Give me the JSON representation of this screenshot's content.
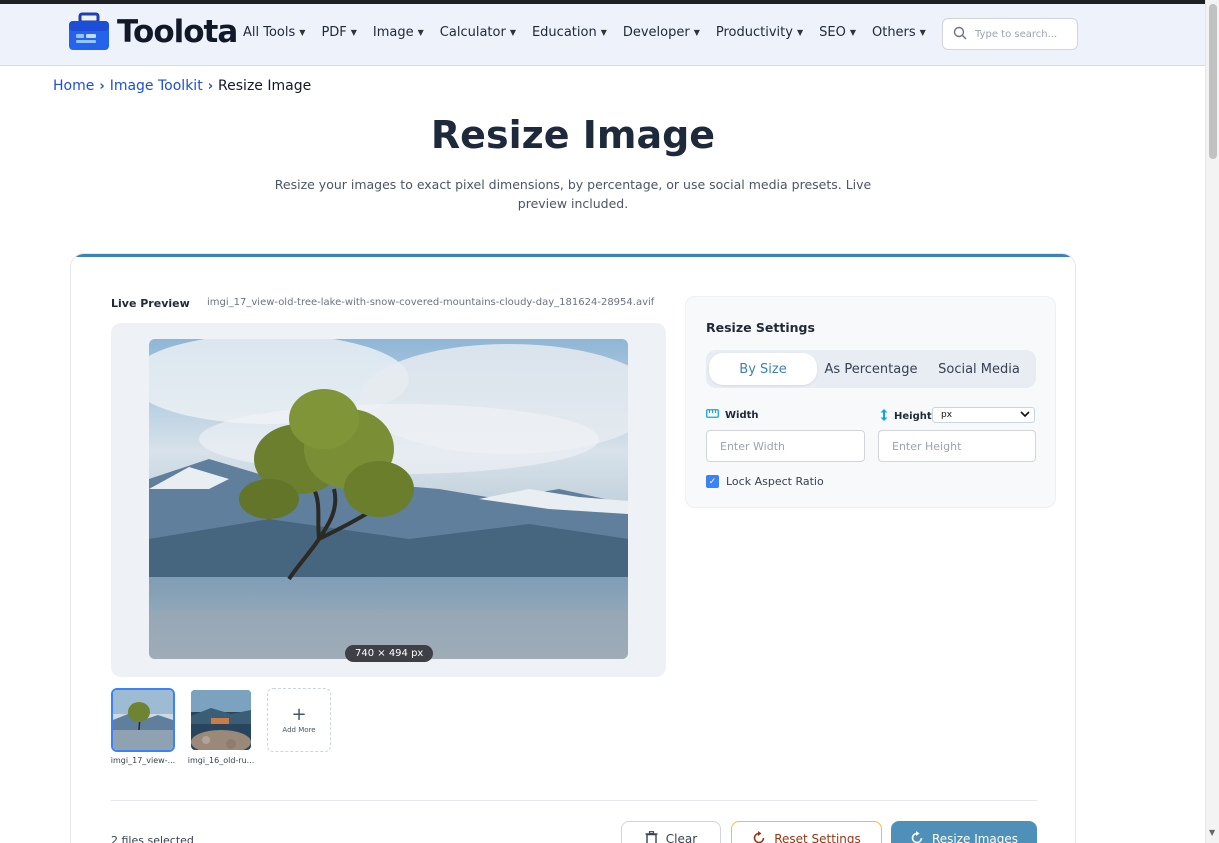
{
  "brand": {
    "name": "Toolota"
  },
  "nav": {
    "items": [
      {
        "label": "All Tools"
      },
      {
        "label": "PDF"
      },
      {
        "label": "Image"
      },
      {
        "label": "Calculator"
      },
      {
        "label": "Education"
      },
      {
        "label": "Developer"
      },
      {
        "label": "Productivity"
      },
      {
        "label": "SEO"
      },
      {
        "label": "Others"
      }
    ],
    "search_placeholder": "Type to search..."
  },
  "breadcrumb": {
    "home": "Home",
    "section": "Image Toolkit",
    "current": "Resize Image"
  },
  "page": {
    "title": "Resize Image",
    "subtitle": "Resize your images to exact pixel dimensions, by percentage, or use social media presets. Live preview included."
  },
  "preview": {
    "label": "Live Preview",
    "file_name": "imgi_17_view-old-tree-lake-with-snow-covered-mountains-cloudy-day_181624-28954.avif",
    "dimensions": "740 × 494 px"
  },
  "thumbnails": [
    {
      "name": "imgi_17_view-...",
      "active": true
    },
    {
      "name": "imgi_16_old-ru...",
      "active": false
    }
  ],
  "add_more_label": "Add More",
  "settings": {
    "title": "Resize Settings",
    "tabs": [
      {
        "label": "By Size",
        "active": true
      },
      {
        "label": "As Percentage",
        "active": false
      },
      {
        "label": "Social Media",
        "active": false
      }
    ],
    "width_label": "Width",
    "height_label": "Height",
    "unit_selected": "px",
    "width_placeholder": "Enter Width",
    "height_placeholder": "Enter Height",
    "width_value": "",
    "height_value": "",
    "lock_aspect_label": "Lock Aspect Ratio",
    "lock_aspect_checked": true
  },
  "footer": {
    "files_selected": "2 files selected",
    "clear_label": "Clear",
    "reset_label": "Reset Settings",
    "resize_label": "Resize Images"
  },
  "colors": {
    "accent": "#3b82b6",
    "link": "#1d4ed8",
    "primary_button": "#4f90b9",
    "reset_border": "#fbbf24"
  }
}
